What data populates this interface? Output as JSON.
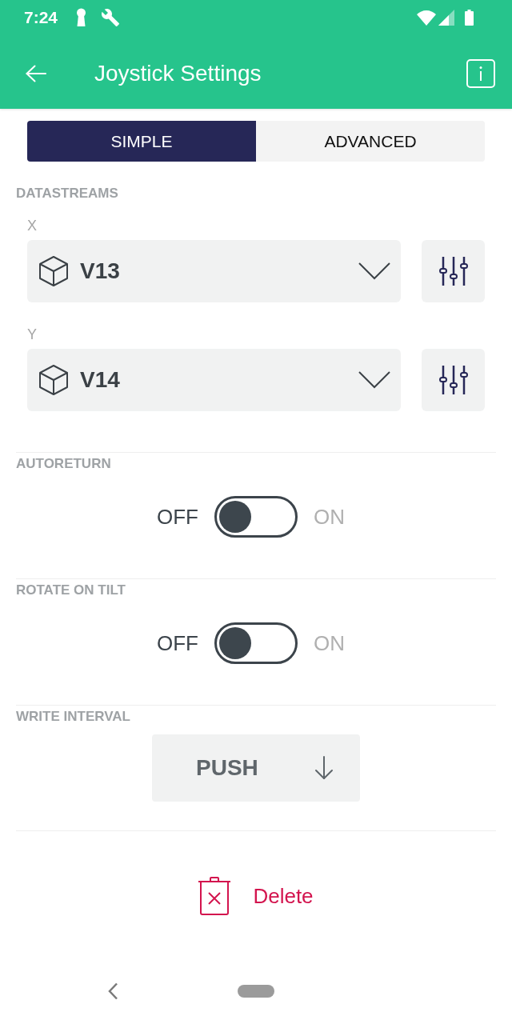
{
  "status_bar": {
    "time": "7:24"
  },
  "app_bar": {
    "title": "Joystick Settings"
  },
  "tabs": [
    {
      "label": "SIMPLE",
      "selected": true
    },
    {
      "label": "ADVANCED",
      "selected": false
    }
  ],
  "datastreams": {
    "title": "DATASTREAMS",
    "pins": [
      {
        "axis": "X",
        "value": "V13"
      },
      {
        "axis": "Y",
        "value": "V14"
      }
    ]
  },
  "switches": [
    {
      "title": "AUTORETURN",
      "off_label": "OFF",
      "on_label": "ON",
      "on": false
    },
    {
      "title": "ROTATE ON TILT",
      "off_label": "OFF",
      "on_label": "ON",
      "on": false
    }
  ],
  "write_interval": {
    "title": "WRITE INTERVAL",
    "value": "PUSH"
  },
  "delete_button": {
    "label": "Delete"
  }
}
